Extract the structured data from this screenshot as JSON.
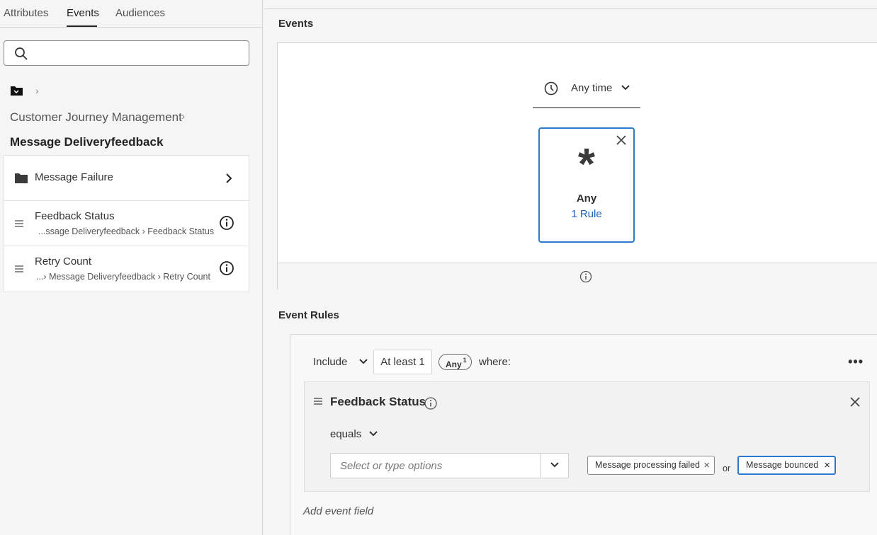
{
  "left_panel": {
    "tabs": [
      {
        "label": "Attributes",
        "active": false
      },
      {
        "label": "Events",
        "active": true
      },
      {
        "label": "Audiences",
        "active": false
      }
    ],
    "search": {
      "value": "",
      "placeholder": ""
    },
    "breadcrumb": {
      "root_icon": "folder-icon",
      "parent": "Customer Journey Management",
      "current": "Message Deliveryfeedback"
    },
    "items": [
      {
        "type": "folder",
        "icon": "folder-icon",
        "label": "Message Failure"
      },
      {
        "type": "field",
        "icon": "drag-handle-icon",
        "label": "Feedback Status",
        "path_prefix": "...ssage Deliveryfeedback",
        "path_leaf": "Feedback Status"
      },
      {
        "type": "field",
        "icon": "drag-handle-icon",
        "label": "Retry Count",
        "path_prefix": "...",
        "path_mid": "Message Deliveryfeedback",
        "path_leaf": "Retry Count"
      }
    ]
  },
  "events_section": {
    "title": "Events",
    "time_filter": "Any time",
    "card": {
      "symbol": "*",
      "label": "Any",
      "rules_link": "1 Rule"
    }
  },
  "rules_section": {
    "title": "Event Rules",
    "include_label": "Include",
    "count_label": "At least 1",
    "any_pill": "Any",
    "any_pill_count": "1",
    "where_label": "where:",
    "field": {
      "name": "Feedback Status",
      "operator": "equals",
      "combo_placeholder": "Select or type options",
      "values": [
        "Message processing failed",
        "Message bounced"
      ],
      "or_label": "or"
    },
    "add_field_label": "Add event field"
  },
  "colors": {
    "accent": "#2c7ac9",
    "link": "#1d62b8"
  }
}
